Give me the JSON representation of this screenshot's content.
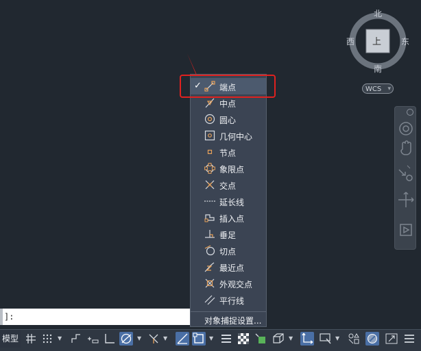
{
  "compass": {
    "north": "北",
    "south": "南",
    "west": "西",
    "east": "东",
    "cube_face": "上"
  },
  "wcs": {
    "label": "WCS"
  },
  "osnap_menu": {
    "items": [
      {
        "label": "端点",
        "checked": true,
        "icon": "endpoint-icon"
      },
      {
        "label": "中点",
        "checked": false,
        "icon": "midpoint-icon"
      },
      {
        "label": "圆心",
        "checked": false,
        "icon": "center-icon"
      },
      {
        "label": "几何中心",
        "checked": false,
        "icon": "geometric-center-icon"
      },
      {
        "label": "节点",
        "checked": false,
        "icon": "node-icon"
      },
      {
        "label": "象限点",
        "checked": false,
        "icon": "quadrant-icon"
      },
      {
        "label": "交点",
        "checked": false,
        "icon": "intersection-icon"
      },
      {
        "label": "延长线",
        "checked": false,
        "icon": "extension-icon"
      },
      {
        "label": "插入点",
        "checked": false,
        "icon": "insertion-icon"
      },
      {
        "label": "垂足",
        "checked": false,
        "icon": "perpendicular-icon"
      },
      {
        "label": "切点",
        "checked": false,
        "icon": "tangent-icon"
      },
      {
        "label": "最近点",
        "checked": false,
        "icon": "nearest-icon"
      },
      {
        "label": "外观交点",
        "checked": false,
        "icon": "apparent-intersection-icon"
      },
      {
        "label": "平行线",
        "checked": false,
        "icon": "parallel-icon"
      }
    ],
    "settings_label": "对象捕捉设置...",
    "check_glyph": "✓"
  },
  "command_line": {
    "text": "]:"
  },
  "status_bar": {
    "model_tab": "模型"
  },
  "colors": {
    "background": "#212830",
    "menu_bg": "#3b4453",
    "snap_orange": "#e8a25a",
    "highlight_red": "#e0211f",
    "active_blue": "#4a6fa5"
  }
}
